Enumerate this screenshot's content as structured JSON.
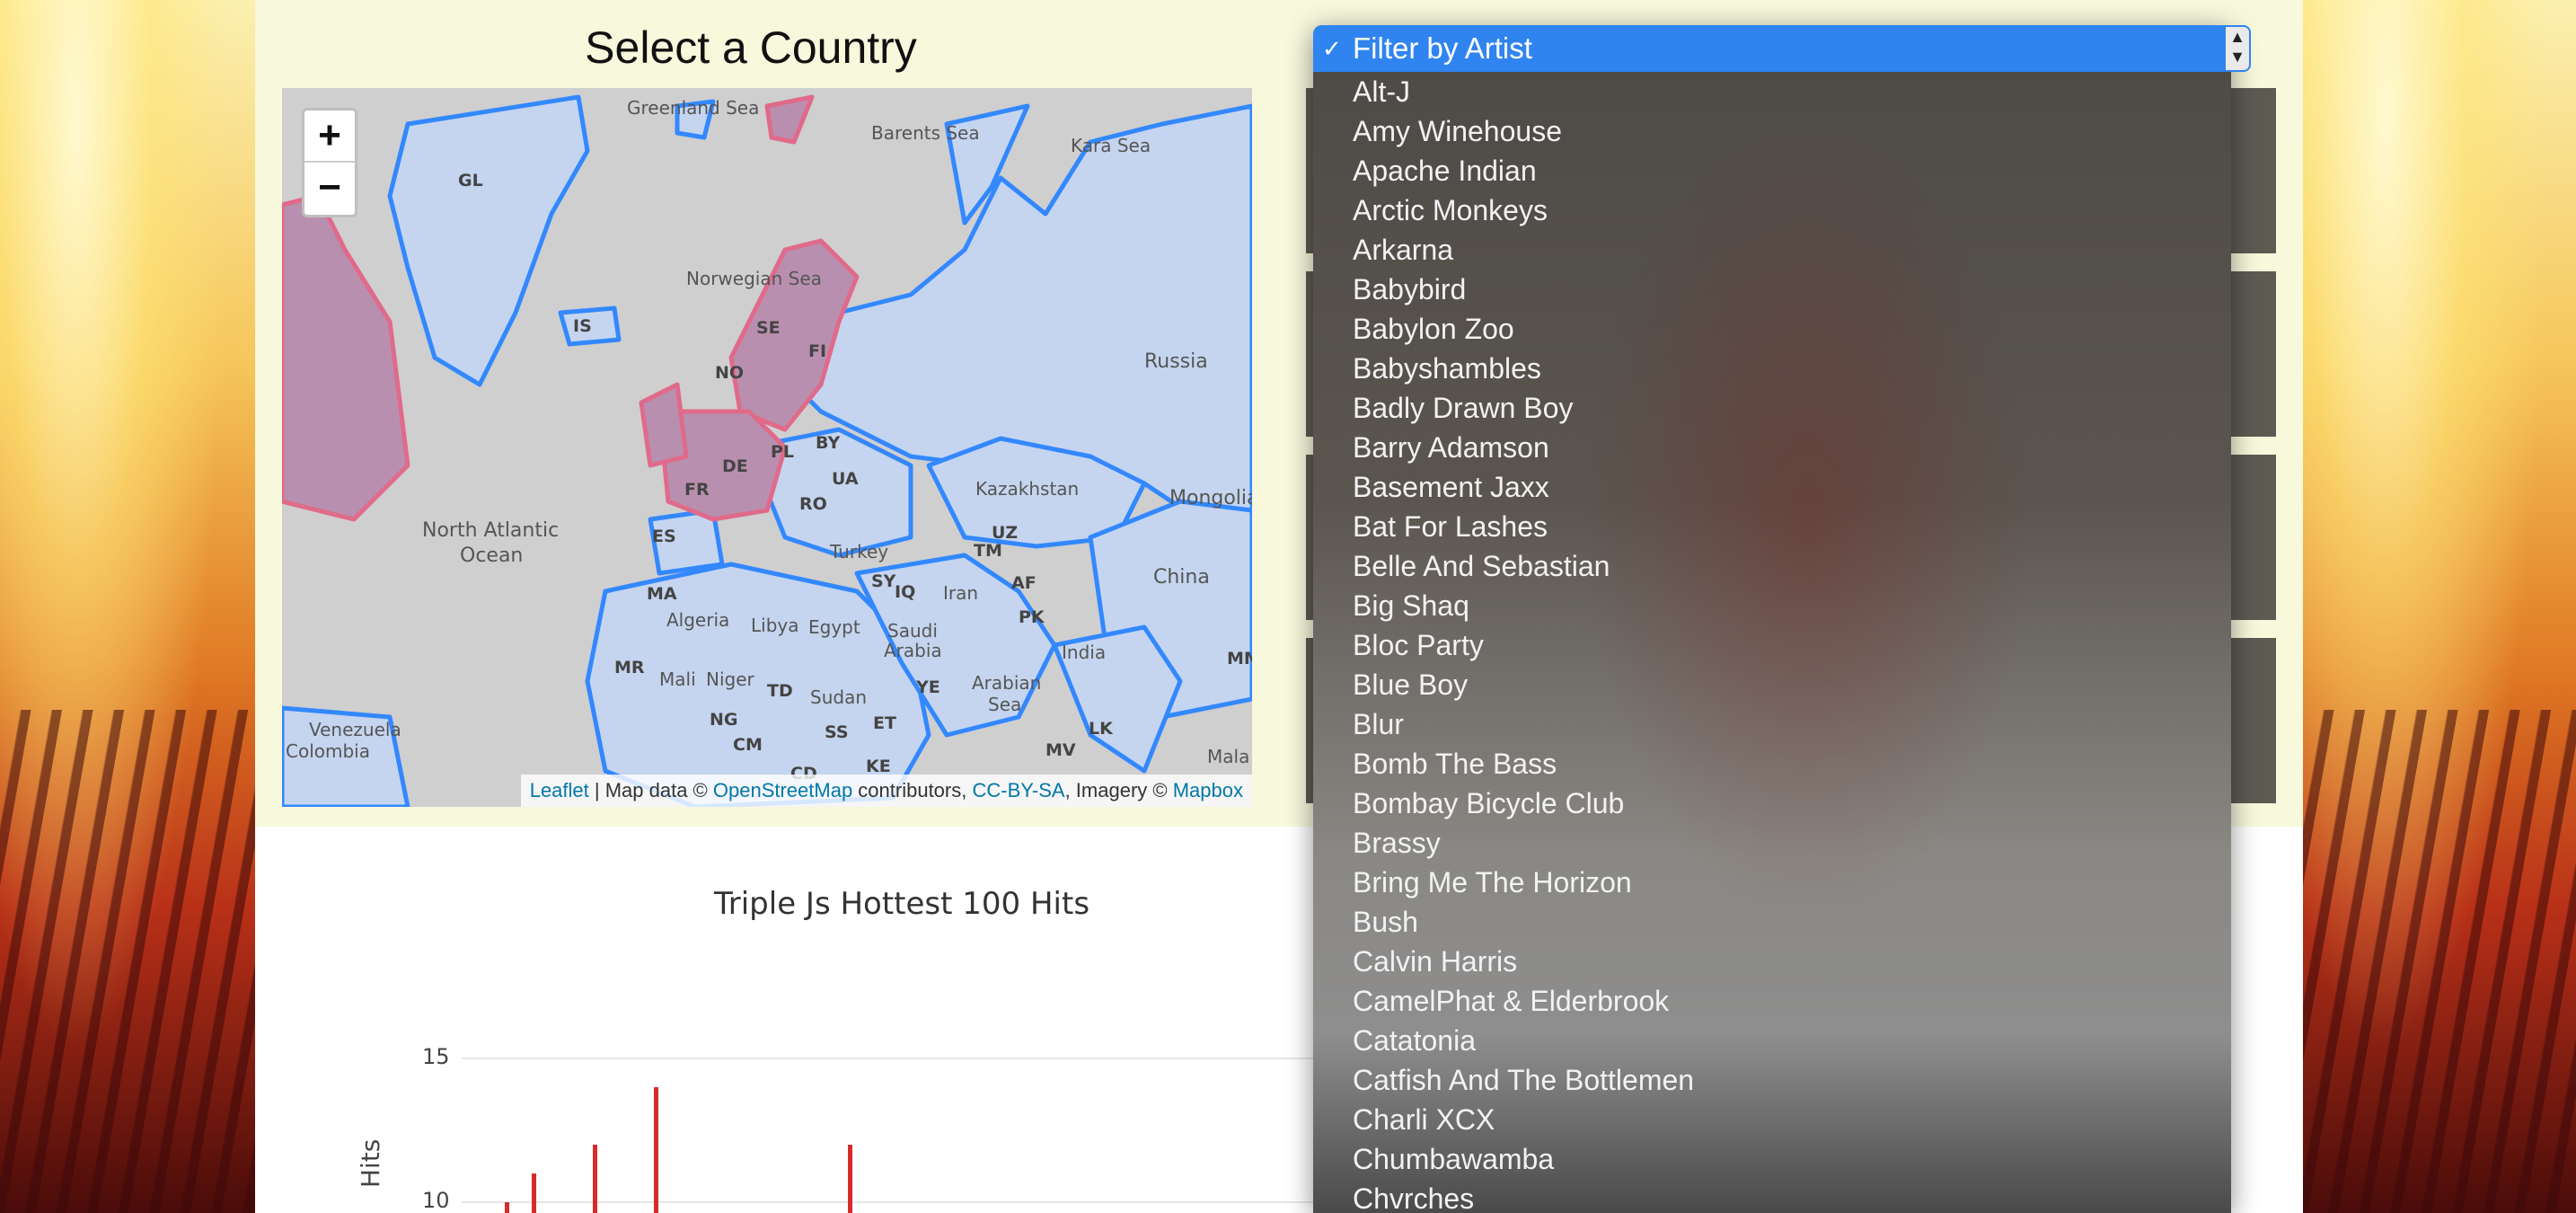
{
  "map": {
    "title": "Select a Country",
    "zoom_in": "+",
    "zoom_out": "−",
    "attribution": {
      "leaflet": "Leaflet",
      "sep": " | Map data © ",
      "osm": "OpenStreetMap",
      "contrib": " contributors, ",
      "license": "CC-BY-SA",
      "imagery": ", Imagery © ",
      "mapbox": "Mapbox"
    },
    "labels": {
      "greenland_sea": "Greenland Sea",
      "barents_sea": "Barents Sea",
      "kara_sea": "Kara Sea",
      "gl": "GL",
      "is": "IS",
      "norwegian_sea": "Norwegian Sea",
      "se": "SE",
      "fi": "FI",
      "no": "NO",
      "russia": "Russia",
      "pl": "PL",
      "by": "BY",
      "ua": "UA",
      "de": "DE",
      "fr": "FR",
      "ro": "RO",
      "es": "ES",
      "kazakhstan": "Kazakhstan",
      "mongolia": "Mongolia",
      "north_atlantic": "North Atlantic",
      "ocean": "Ocean",
      "turkey": "Turkey",
      "tm": "TM",
      "uz": "UZ",
      "sy": "SY",
      "iq": "IQ",
      "iran": "Iran",
      "af": "AF",
      "china": "China",
      "ma": "MA",
      "algeria": "Algeria",
      "libya": "Libya",
      "egypt": "Egypt",
      "saudi": "Saudi",
      "arabia": "Arabia",
      "pk": "PK",
      "india": "India",
      "mr": "MR",
      "mali": "Mali",
      "niger": "Niger",
      "td": "TD",
      "sudan": "Sudan",
      "ye": "YE",
      "arabian": "Arabian",
      "sea": "Sea",
      "mm": "MM",
      "ng": "NG",
      "et": "ET",
      "ss": "SS",
      "cm": "CM",
      "cd": "CD",
      "ke": "KE",
      "mv": "MV",
      "lk": "LK",
      "venezuela": "Venezuela",
      "colombia": "Colombia",
      "mala": "Mala"
    }
  },
  "chart": {
    "title": "Triple Js Hottest 100 Hits",
    "ylabel": "Hits",
    "ticks": [
      "15",
      "10"
    ]
  },
  "chart_data": {
    "type": "bar",
    "title": "Triple Js Hottest 100 Hits",
    "ylabel": "Hits",
    "ylim": [
      8,
      16
    ],
    "bars": [
      {
        "x": 1,
        "value": 10
      },
      {
        "x": 2,
        "value": 11
      },
      {
        "x": 3,
        "value": 12
      },
      {
        "x": 4,
        "value": 14
      },
      {
        "x": 5,
        "value": 12
      }
    ],
    "color": "#d62b2b"
  },
  "dropdown": {
    "selected": "Filter by Artist",
    "check": "✓",
    "arrow_up": "▲",
    "arrow_down": "▼",
    "options": [
      "Alt-J",
      "Amy Winehouse",
      "Apache Indian",
      "Arctic Monkeys",
      "Arkarna",
      "Babybird",
      "Babylon Zoo",
      "Babyshambles",
      "Badly Drawn Boy",
      "Barry Adamson",
      "Basement Jaxx",
      "Bat For Lashes",
      "Belle And Sebastian",
      "Big Shaq",
      "Bloc Party",
      "Blue Boy",
      "Blur",
      "Bomb The Bass",
      "Bombay Bicycle Club",
      "Brassy",
      "Bring Me The Horizon",
      "Bush",
      "Calvin Harris",
      "CamelPhat & Elderbrook",
      "Catatonia",
      "Catfish And The Bottlemen",
      "Charli XCX",
      "Chumbawamba",
      "Chvrches"
    ]
  },
  "colors": {
    "accent": "#2f84f0",
    "border": "#3388ff",
    "selected_fill": "#b98fb0",
    "bar": "#d62b2b"
  }
}
